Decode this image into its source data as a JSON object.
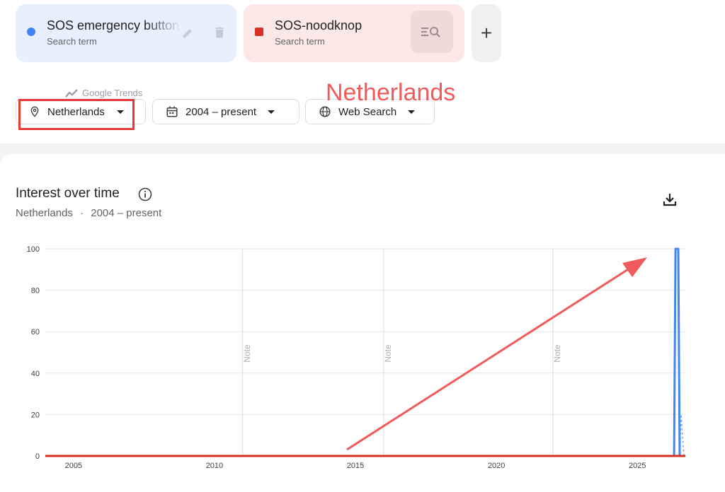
{
  "terms": [
    {
      "title": "SOS emergency button",
      "subtitle": "Search term",
      "color": "#4285f4"
    },
    {
      "title": "SOS-noodknop",
      "subtitle": "Search term",
      "color": "#d93025"
    }
  ],
  "add_label": "+",
  "filters": {
    "location": "Netherlands",
    "period": "2004 – present",
    "property": "Web Search"
  },
  "section": {
    "title": "Interest over time",
    "location": "Netherlands",
    "separator": "·",
    "period": "2004 – present",
    "watermark": "Google Trends"
  },
  "annotation": {
    "text": "Netherlands",
    "color": "#f05a5a"
  },
  "chart_data": {
    "type": "line",
    "y_ticks": [
      "100",
      "80",
      "60",
      "40",
      "20",
      "0"
    ],
    "x_ticks": [
      "2005",
      "2010",
      "2015",
      "2020",
      "2025"
    ],
    "ylim": [
      0,
      100
    ],
    "xlim": [
      2004,
      2026.7
    ],
    "notes": [
      {
        "label": "Note",
        "x": 2011.0
      },
      {
        "label": "Note",
        "x": 2016.0
      },
      {
        "label": "Note",
        "x": 2022.0
      }
    ],
    "series": [
      {
        "name": "SOS emergency button",
        "color": "#4285f4",
        "points": [
          [
            2004,
            0
          ],
          [
            2026.3,
            0
          ],
          [
            2026.35,
            100
          ],
          [
            2026.45,
            100
          ],
          [
            2026.5,
            0
          ]
        ],
        "projection": [
          [
            2026.5,
            0
          ],
          [
            2026.55,
            20
          ],
          [
            2026.65,
            0
          ]
        ]
      },
      {
        "name": "SOS-noodknop",
        "color": "#d93025",
        "points": [
          [
            2004,
            0
          ],
          [
            2026.7,
            0
          ]
        ]
      }
    ]
  }
}
